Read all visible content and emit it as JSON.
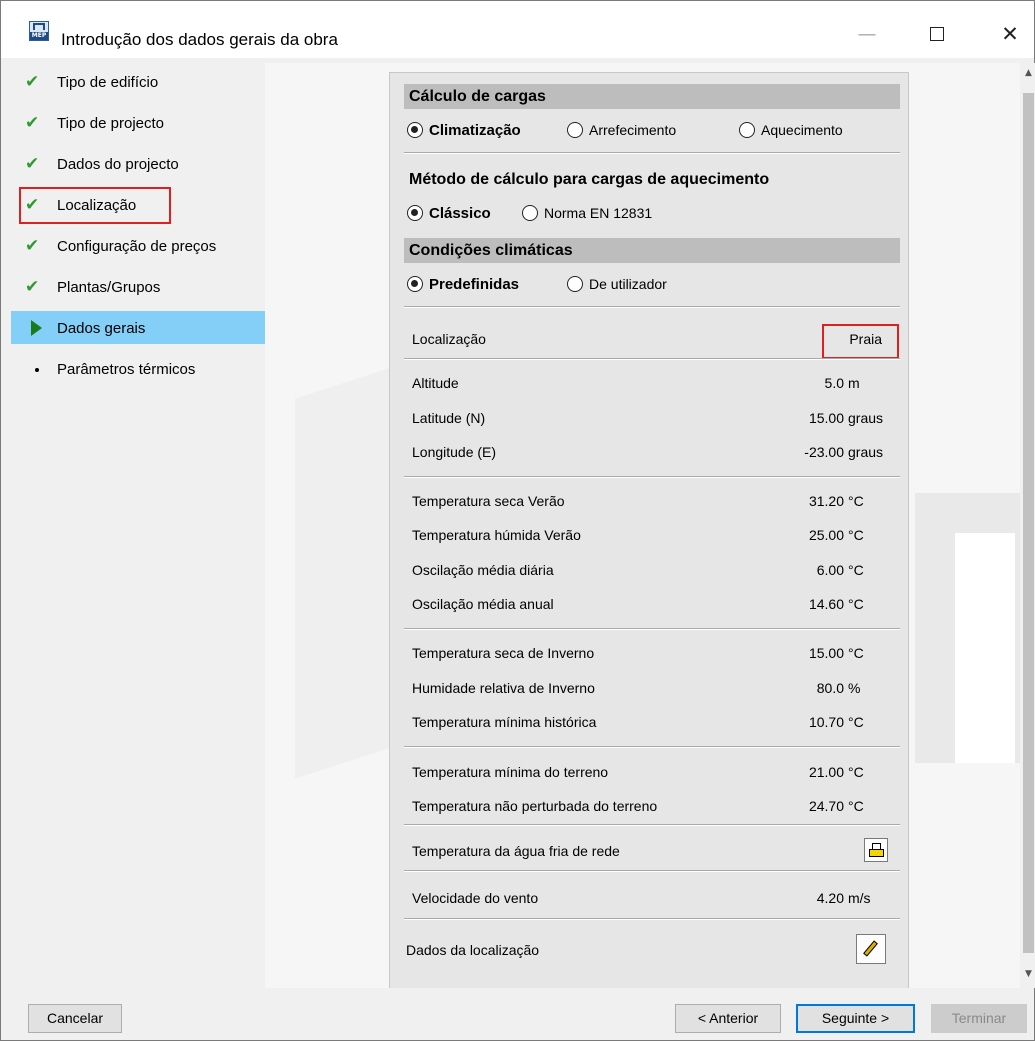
{
  "window": {
    "title": "Introdução dos dados gerais da obra",
    "icon_text": "MEP"
  },
  "sidebar": {
    "items": [
      {
        "label": "Tipo de edifício",
        "state": "done"
      },
      {
        "label": "Tipo de projecto",
        "state": "done"
      },
      {
        "label": "Dados do projecto",
        "state": "done"
      },
      {
        "label": "Localização",
        "state": "done"
      },
      {
        "label": "Configuração de preços",
        "state": "done"
      },
      {
        "label": "Plantas/Grupos",
        "state": "done"
      },
      {
        "label": "Dados gerais",
        "state": "current"
      },
      {
        "label": "Parâmetros térmicos",
        "state": "pending"
      }
    ]
  },
  "panel": {
    "loads": {
      "title": "Cálculo de cargas",
      "options": [
        "Climatização",
        "Arrefecimento",
        "Aquecimento"
      ],
      "selected": "Climatização"
    },
    "method": {
      "title": "Método de cálculo para cargas de aquecimento",
      "options": [
        "Clássico",
        "Norma EN 12831"
      ],
      "selected": "Clássico"
    },
    "climate": {
      "title": "Condições climáticas",
      "options": [
        "Predefinidas",
        "De utilizador"
      ],
      "selected": "Predefinidas"
    },
    "location": {
      "label": "Localização",
      "value": "Praia"
    },
    "rows": {
      "altitude": {
        "label": "Altitude",
        "value": "5.0",
        "unit": "m"
      },
      "latitude": {
        "label": "Latitude (N)",
        "value": "15.00",
        "unit": "graus"
      },
      "longitude": {
        "label": "Longitude (E)",
        "value": "-23.00",
        "unit": "graus"
      },
      "t_dry_summer": {
        "label": "Temperatura seca Verão",
        "value": "31.20",
        "unit": "°C"
      },
      "t_wet_summer": {
        "label": "Temperatura húmida Verão",
        "value": "25.00",
        "unit": "°C"
      },
      "osc_daily": {
        "label": "Oscilação média diária",
        "value": "6.00",
        "unit": "°C"
      },
      "osc_annual": {
        "label": "Oscilação média anual",
        "value": "14.60",
        "unit": "°C"
      },
      "t_dry_winter": {
        "label": "Temperatura seca de Inverno",
        "value": "15.00",
        "unit": "°C"
      },
      "rh_winter": {
        "label": "Humidade relativa de Inverno",
        "value": "80.0",
        "unit": "%"
      },
      "t_min_hist": {
        "label": "Temperatura mínima histórica",
        "value": "10.70",
        "unit": "°C"
      },
      "t_min_ground": {
        "label": "Temperatura mínima do terreno",
        "value": "21.00",
        "unit": "°C"
      },
      "t_undisturbed_ground": {
        "label": "Temperatura não perturbada do terreno",
        "value": "24.70",
        "unit": "°C"
      },
      "wind": {
        "label": "Velocidade do vento",
        "value": "4.20",
        "unit": "m/s"
      }
    },
    "water_label": "Temperatura da água fria de rede",
    "location_data_label": "Dados da localização"
  },
  "footer": {
    "cancel": "Cancelar",
    "previous": "< Anterior",
    "next": "Seguinte >",
    "finish": "Terminar"
  },
  "icons": {
    "done": "check-icon",
    "current": "triangle-icon",
    "pending": "bullet-icon",
    "water": "printer-icon",
    "location_data": "pencil-icon"
  }
}
